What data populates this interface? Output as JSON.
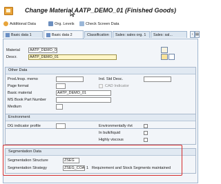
{
  "title": "Change Material AATP_DEMO_01 (Finished Goods)",
  "toolbar": {
    "additional_data": "Additional Data",
    "org_levels": "Org. Levels",
    "check_screen_data": "Check Screen Data"
  },
  "tabs": [
    "Basic data 1",
    "Basic data 2",
    "Classification",
    "Sales: sales org. 1",
    "Sales: sal..."
  ],
  "active_tab": "Basic data 2",
  "header": {
    "material_label": "Material",
    "material_value": "AATP_DEMO_01",
    "descr_label": "Descr.",
    "descr_value": "AATP_DEMO_01"
  },
  "other_data": {
    "title": "Other Data",
    "prod_insp_memo": "Prod./insp. memo",
    "ind_std_desc": "Ind. Std Desc.",
    "page_format": "Page format",
    "cad_indicator": "CAD Indicator",
    "basic_material": "Basic material",
    "basic_material_value": "AATP_DEMO_01",
    "ms_book_part_number": "MS Book Part Number",
    "medium": "Medium"
  },
  "environment": {
    "title": "Environment",
    "dg_indicator_profile": "DG indicator profile",
    "environmentally_rlvt": "Environmentally rlvt",
    "in_bulk_liquid": "In bulk/liquid",
    "highly_viscous": "Highly viscous"
  },
  "segmentation": {
    "title": "Segmentation Data",
    "structure_label": "Segmentation Structure",
    "structure_value": "ZSEG",
    "strategy_label": "Segmentation Strategy",
    "strategy_value": "ZSEG_COA",
    "strategy_value_count": "1",
    "strategy_desc": "Requirement and Stock Segments maintained"
  },
  "colors": {
    "highlight": "#d42a2a",
    "tab_bg": "#dde7f1",
    "panel_bg": "#f2f5f9",
    "required_field_bg": "#fff6c8"
  }
}
